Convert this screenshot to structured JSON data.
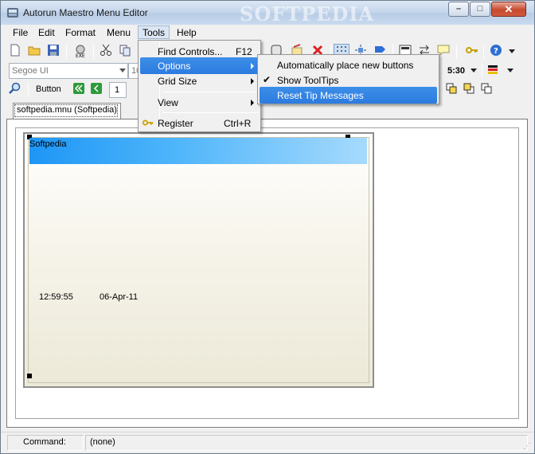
{
  "window": {
    "title": "Autorun Maestro Menu Editor",
    "watermark": "SOFTPEDIA",
    "min_glyph": "–",
    "max_glyph": "□",
    "close_glyph": "✕"
  },
  "menubar": {
    "items": [
      "File",
      "Edit",
      "Format",
      "Menu",
      "Tools",
      "Help"
    ],
    "open_item": "Tools"
  },
  "toolbar": {
    "font_combo": "Segoe UI",
    "size_combo": "10",
    "time_format_label": "5:30",
    "control_type_label": "Button",
    "index_value": "1"
  },
  "tools_menu": {
    "items": [
      {
        "label": "Find Controls...",
        "shortcut": "F12",
        "submenu": false
      },
      {
        "label": "Options",
        "shortcut": "",
        "submenu": true,
        "highlighted": true
      },
      {
        "label": "Grid Size",
        "shortcut": "",
        "submenu": true
      },
      {
        "label": "View",
        "shortcut": "",
        "submenu": true
      },
      {
        "label": "Register",
        "shortcut": "Ctrl+R",
        "submenu": false,
        "icon": "key-icon"
      }
    ]
  },
  "options_menu": {
    "items": [
      {
        "label": "Automatically place new buttons",
        "checked": false
      },
      {
        "label": "Show ToolTips",
        "checked": true
      },
      {
        "label": "Reset Tip Messages",
        "checked": false,
        "highlighted": true
      }
    ],
    "check_glyph": "✔"
  },
  "document": {
    "tab_label": "softpedia.mnu (Softpedia)",
    "banner_label": "Softpedia",
    "clock_text": "12:59:55",
    "date_text": "06-Apr-11"
  },
  "statusbar": {
    "label": "Command:",
    "value": "(none)"
  },
  "colors": {
    "menu_highlight": "#2c7be0",
    "banner_start": "#1e96f5",
    "banner_end": "#a6dafd"
  }
}
